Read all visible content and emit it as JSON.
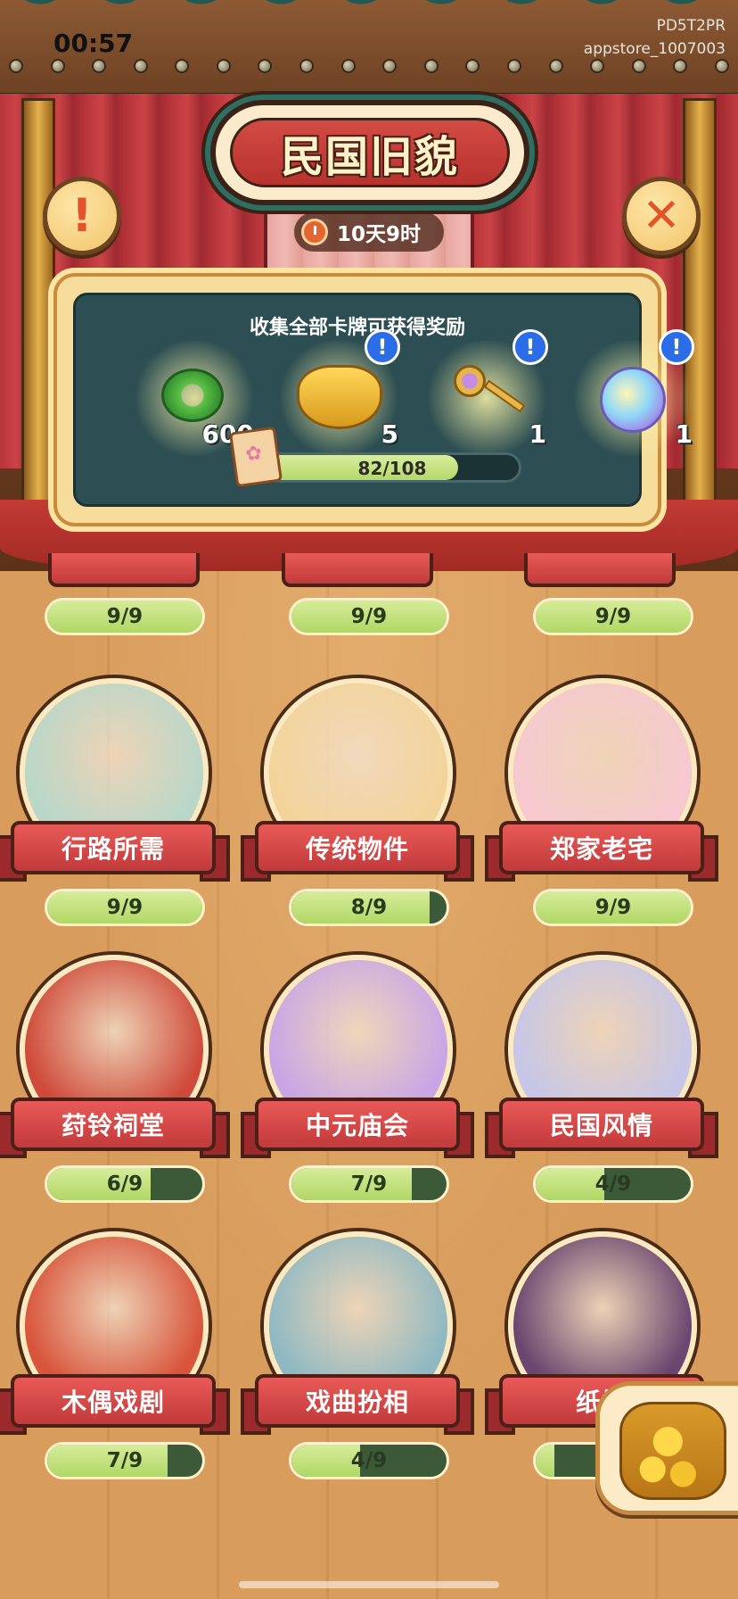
{
  "status": {
    "time": "00:57",
    "device_line1": "PD5T2PR",
    "device_line2": "appstore_1007003"
  },
  "header": {
    "title": "民国旧貌",
    "timer": "10天9时",
    "info_symbol": "!",
    "close_symbol": "✕"
  },
  "rewards": {
    "header": "收集全部卡牌可获得奖励",
    "items": [
      {
        "name": "jade-coin",
        "count": "600",
        "has_alert": false
      },
      {
        "name": "treasure-chest",
        "count": "5",
        "has_alert": true
      },
      {
        "name": "golden-key",
        "count": "1",
        "has_alert": true
      },
      {
        "name": "crystal-orb",
        "count": "1",
        "has_alert": true
      }
    ],
    "alert_symbol": "!",
    "progress": {
      "text": "82/108",
      "current": 82,
      "total": 108
    }
  },
  "top_row_progress": [
    {
      "text": "9/9",
      "fraction": 1.0
    },
    {
      "text": "9/9",
      "fraction": 1.0
    },
    {
      "text": "9/9",
      "fraction": 1.0
    }
  ],
  "collections": [
    {
      "label": "行路所需",
      "progress": "9/9",
      "fraction": 1.0,
      "art_color": "#b9d7c9"
    },
    {
      "label": "传统物件",
      "progress": "8/9",
      "fraction": 0.889,
      "art_color": "#f2d49a"
    },
    {
      "label": "郑家老宅",
      "progress": "9/9",
      "fraction": 1.0,
      "art_color": "#f6c8d0"
    },
    {
      "label": "荮铃祠堂",
      "progress": "6/9",
      "fraction": 0.667,
      "art_color": "#cf4a3a"
    },
    {
      "label": "中元庙会",
      "progress": "7/9",
      "fraction": 0.778,
      "art_color": "#c8a6e6"
    },
    {
      "label": "民国风情",
      "progress": "4/9",
      "fraction": 0.444,
      "art_color": "#c6c6e8"
    },
    {
      "label": "木偶戏剧",
      "progress": "7/9",
      "fraction": 0.778,
      "art_color": "#d8543b"
    },
    {
      "label": "戏曲扮相",
      "progress": "4/9",
      "fraction": 0.444,
      "art_color": "#8fb9c2"
    },
    {
      "label": "纸嫁",
      "progress": "",
      "fraction": 0.12,
      "art_color": "#6a4670"
    }
  ],
  "colors": {
    "accent_red": "#c23a3b",
    "progress_green": "#b4d86a",
    "panel_teal": "#2d4e52"
  }
}
